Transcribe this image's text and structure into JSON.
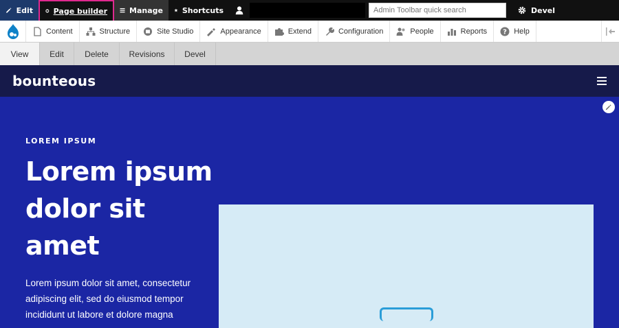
{
  "toolbar": {
    "edit_label": "Edit",
    "page_builder_label": "Page builder",
    "manage_label": "Manage",
    "shortcuts_label": "Shortcuts",
    "search_placeholder": "Admin Toolbar quick search",
    "devel_label": "Devel"
  },
  "menu": {
    "items": [
      {
        "label": "Content"
      },
      {
        "label": "Structure"
      },
      {
        "label": "Site Studio"
      },
      {
        "label": "Appearance"
      },
      {
        "label": "Extend"
      },
      {
        "label": "Configuration"
      },
      {
        "label": "People"
      },
      {
        "label": "Reports"
      },
      {
        "label": "Help"
      }
    ]
  },
  "tabs": [
    {
      "label": "View",
      "active": true
    },
    {
      "label": "Edit"
    },
    {
      "label": "Delete"
    },
    {
      "label": "Revisions"
    },
    {
      "label": "Devel"
    }
  ],
  "site": {
    "brand": "bounteous"
  },
  "hero": {
    "eyebrow": "LOREM IPSUM",
    "headline": "Lorem ipsum dolor sit amet",
    "body": "Lorem ipsum dolor sit amet, consectetur adipiscing elit, sed do eiusmod tempor incididunt ut labore et dolore magna"
  },
  "colors": {
    "accent_highlight": "#e0298f",
    "hero_bg": "#1b26a4",
    "header_bg": "#161a4a",
    "media_bg": "#d6ebf6"
  }
}
